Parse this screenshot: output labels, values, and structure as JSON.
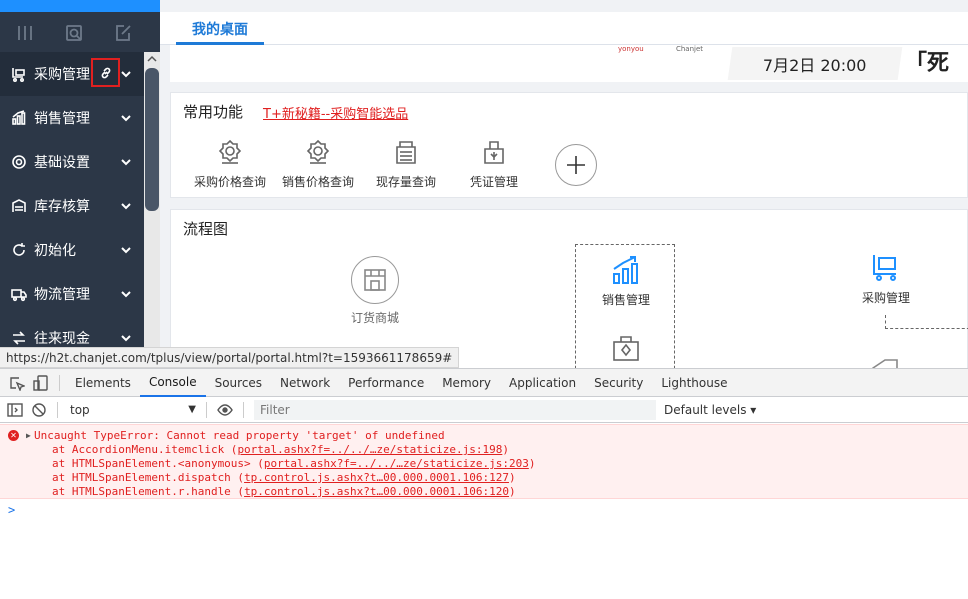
{
  "sidebar": {
    "tools": [
      "columns-icon",
      "search-doc-icon",
      "edit-icon"
    ],
    "items": [
      {
        "label": "采购管理",
        "icon": "cart-icon",
        "active": true
      },
      {
        "label": "销售管理",
        "icon": "chart-icon"
      },
      {
        "label": "基础设置",
        "icon": "gear-icon"
      },
      {
        "label": "库存核算",
        "icon": "warehouse-icon"
      },
      {
        "label": "初始化",
        "icon": "refresh-icon"
      },
      {
        "label": "物流管理",
        "icon": "truck-icon"
      },
      {
        "label": "往来现金",
        "icon": "exchange-icon"
      }
    ]
  },
  "tabs": {
    "desk": "我的桌面"
  },
  "banner": {
    "logo1": "yonyou",
    "logo2": "Chanjet",
    "date": "7月2日  20:00",
    "slogan": "「死钱"
  },
  "common": {
    "title": "常用功能",
    "promo_link": "T+新秘籍--采购智能选品",
    "functions": [
      "采购价格查询",
      "销售价格查询",
      "现存量查询",
      "凭证管理"
    ]
  },
  "flow": {
    "title": "流程图",
    "order_mall": "订货商城",
    "sales": "销售管理",
    "purchase": "采购管理"
  },
  "status_url": "https://h2t.chanjet.com/tplus/view/portal/portal.html?t=1593661178659#",
  "devtools": {
    "tabs": [
      "Elements",
      "Console",
      "Sources",
      "Network",
      "Performance",
      "Memory",
      "Application",
      "Security",
      "Lighthouse"
    ],
    "active_tab": "Console",
    "context": "top",
    "filter_placeholder": "Filter",
    "levels": "Default levels ▾",
    "error": {
      "message": "Uncaught TypeError: Cannot read property 'target' of undefined",
      "stack": [
        {
          "at": "at AccordionMenu.itemclick (",
          "loc": "portal.ashx?f=../../…ze/staticize.js:198",
          "end": ")"
        },
        {
          "at": "at HTMLSpanElement.<anonymous> (",
          "loc": "portal.ashx?f=../../…ze/staticize.js:203",
          "end": ")"
        },
        {
          "at": "at HTMLSpanElement.dispatch (",
          "loc": "tp.control.js.ashx?t…00.000.0001.106:127",
          "end": ")"
        },
        {
          "at": "at HTMLSpanElement.r.handle (",
          "loc": "tp.control.js.ashx?t…00.000.0001.106:120",
          "end": ")"
        }
      ]
    },
    "prompt": ">"
  },
  "colors": {
    "sidebar": "#2c3747",
    "accent": "#1e90ff",
    "error": "#e02020"
  }
}
